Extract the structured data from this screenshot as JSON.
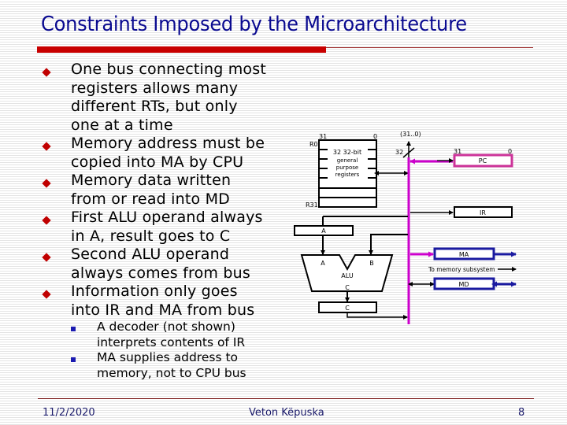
{
  "slide": {
    "title": "Constraints Imposed by the Microarchitecture",
    "bullets": [
      {
        "lines": [
          "One bus connecting most",
          "registers allows many",
          "different RTs, but only",
          "one at a time"
        ]
      },
      {
        "lines": [
          "Memory address must be",
          "copied into MA by CPU"
        ]
      },
      {
        "lines": [
          "Memory data written",
          "from or read into MD"
        ]
      },
      {
        "lines": [
          "First ALU operand always",
          "in A, result goes to C"
        ]
      },
      {
        "lines": [
          "Second ALU operand",
          "always comes from bus"
        ]
      },
      {
        "lines": [
          "Information only goes",
          "into IR and MA from bus"
        ]
      }
    ],
    "sub_bullets": [
      {
        "lines": [
          "A decoder (not shown)",
          "interprets contents of IR"
        ]
      },
      {
        "lines": [
          "MA supplies address to",
          "memory, not to CPU bus"
        ]
      }
    ]
  },
  "diagram": {
    "register_file": {
      "label_lines": [
        "32 32-bit",
        "general",
        "purpose",
        "registers"
      ],
      "top_reg": "R0",
      "bottom_reg": "R31",
      "msb": "31",
      "lsb": "0"
    },
    "bus": {
      "range_label": "(31..0)",
      "width_label": "32"
    },
    "pc": {
      "label": "PC",
      "msb": "31",
      "lsb": "0"
    },
    "ir": {
      "label": "IR"
    },
    "a_reg": {
      "label": "A"
    },
    "alu": {
      "label": "ALU",
      "input_a": "A",
      "input_b": "B",
      "output": "C"
    },
    "c_reg": {
      "label": "C"
    },
    "ma": {
      "label": "MA"
    },
    "md": {
      "label": "MD"
    },
    "memory_note": "To memory subsystem",
    "colors": {
      "bus": "#cc00cc",
      "pc_border": "#cc3399",
      "memory_regs": "#1a1aa0",
      "wire": "#000000"
    }
  },
  "footer": {
    "date": "11/2/2020",
    "author": "Veton Këpuska",
    "page": "8"
  }
}
